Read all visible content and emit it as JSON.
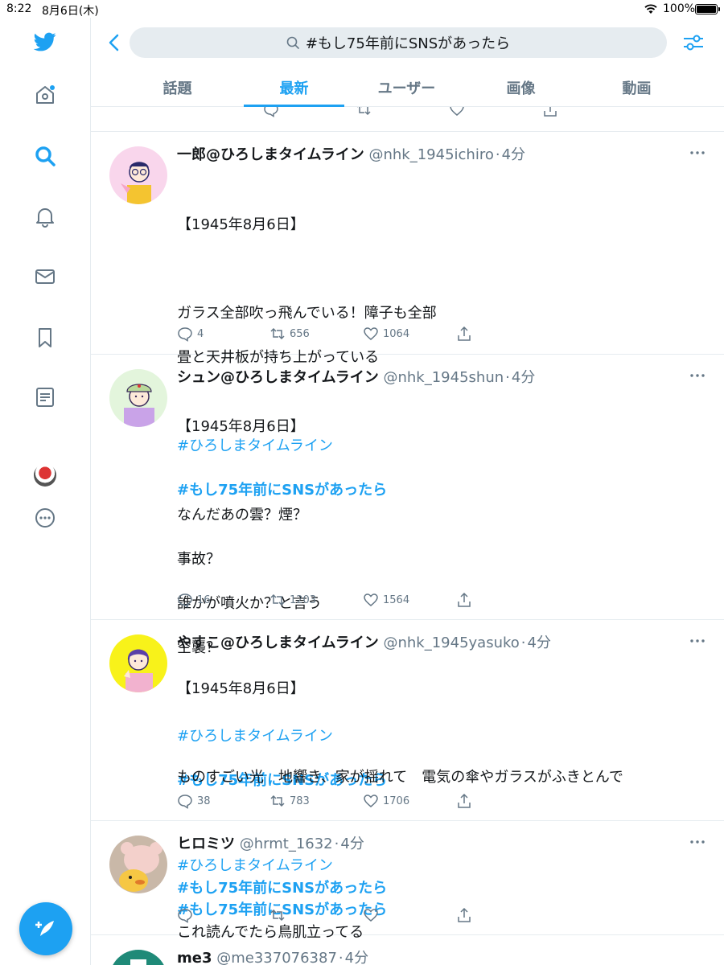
{
  "status_bar": {
    "time": "8:22",
    "date": "8月6日(木)",
    "battery": "100%"
  },
  "header": {
    "search_query": "#もし75年前にSNSがあったら",
    "tabs": [
      "話題",
      "最新",
      "ユーザー",
      "画像",
      "動画"
    ],
    "active_tab": "最新"
  },
  "sidebar": {
    "items": [
      "twitter-logo",
      "home-icon",
      "search-icon",
      "notifications-icon",
      "messages-icon",
      "bookmarks-icon",
      "lists-icon",
      "profile-avatar",
      "more-icon"
    ],
    "compose": "compose-tweet"
  },
  "colors": {
    "accent": "#1da1f2",
    "secondary_text": "#657786",
    "border": "#e6ecf0"
  },
  "tweets": [
    {
      "name": "一郎@ひろしまタイムライン",
      "handle": "@nhk_1945ichiro",
      "time": "4分",
      "lines": [
        "【1945年8月6日】",
        "",
        "ガラス全部吹っ飛んでいる！障子も全部",
        "畳と天井板が持ち上がっている",
        ""
      ],
      "hashtag1": "#ひろしまタイムライン",
      "hashtag2": "#もし75年前にSNSがあったら",
      "replies": "4",
      "retweets": "656",
      "likes": "1064"
    },
    {
      "name": "シュン@ひろしまタイムライン",
      "handle": "@nhk_1945shun",
      "time": "4分",
      "lines": [
        "【1945年8月6日】",
        "",
        "なんだあの雲？煙？",
        "事故？",
        "誰かが噴火か？と言う",
        "空襲？",
        ""
      ],
      "hashtag1": "#ひろしまタイムライン",
      "hashtag2": "#もし75年前にSNSがあったら",
      "replies": "16",
      "retweets": "1203",
      "likes": "1564"
    },
    {
      "name": "やすこ@ひろしまタイムライン",
      "handle": "@nhk_1945yasuko",
      "time": "4分",
      "lines": [
        "【1945年8月6日】",
        "",
        "ものすごい光　地響き、家が揺れて　電気の傘やガラスがふきとんで",
        ""
      ],
      "hashtag1": "#ひろしまタイムライン",
      "hashtag2": "#もし75年前にSNSがあったら",
      "replies": "38",
      "retweets": "783",
      "likes": "1706"
    },
    {
      "name": "ヒロミツ",
      "handle": "@hrmt_1632",
      "time": "4分",
      "hashtag": "#もし75年前にSNSがあったら",
      "text": "これ読んでたら鳥肌立ってる"
    },
    {
      "name": "me3",
      "handle": "@me337076387",
      "time": "4分"
    }
  ]
}
